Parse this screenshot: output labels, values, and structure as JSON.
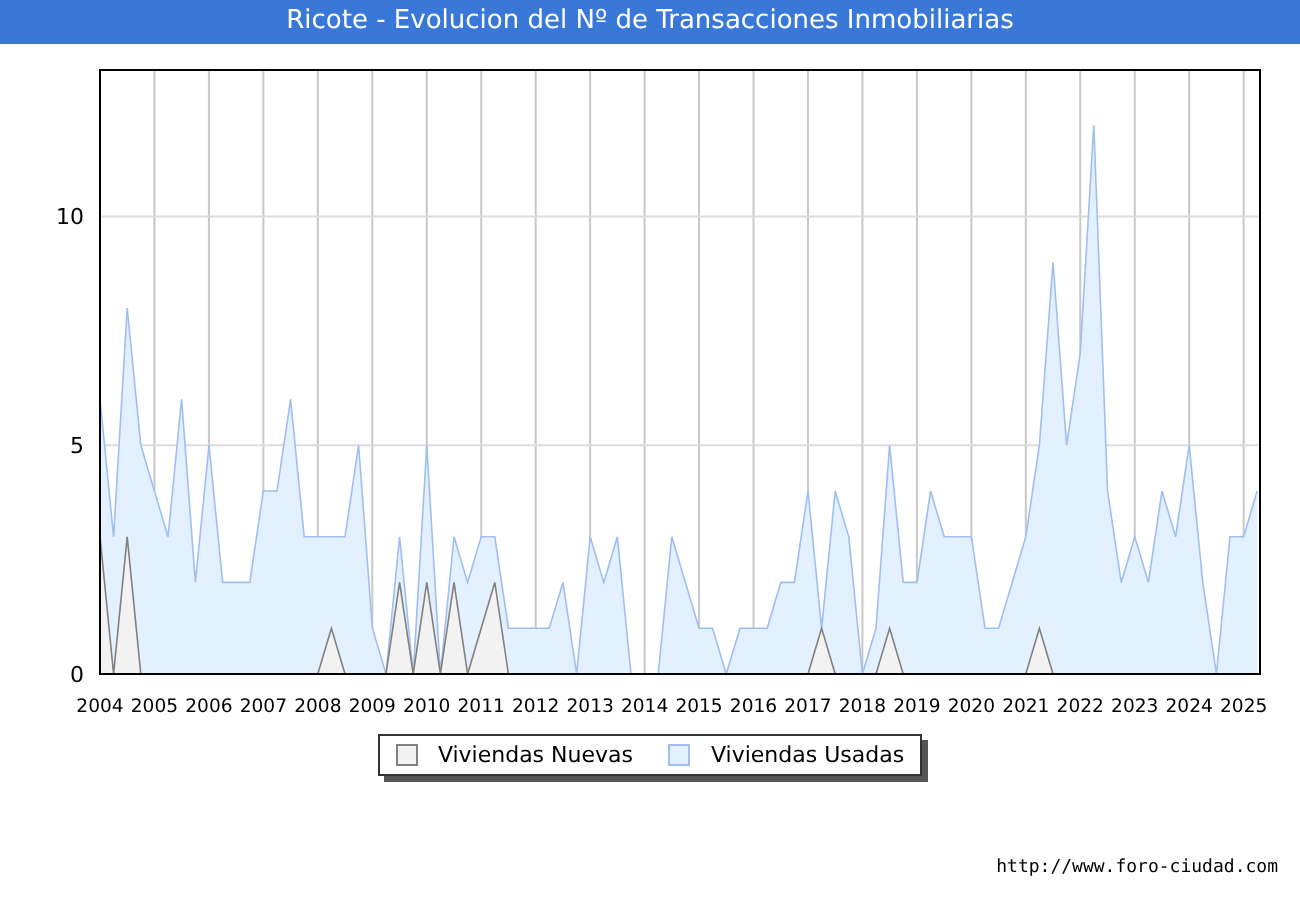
{
  "window": {
    "title": "Ricote - Evolucion del Nº de Transacciones Inmobiliarias"
  },
  "chart": {
    "chart_data": {
      "type": "area",
      "grid": true,
      "xlim": [
        2004,
        2025.3
      ],
      "ylim": [
        0,
        13.2
      ],
      "xticks": [
        2004,
        2005,
        2006,
        2007,
        2008,
        2009,
        2010,
        2011,
        2012,
        2013,
        2014,
        2015,
        2016,
        2017,
        2018,
        2019,
        2020,
        2021,
        2022,
        2023,
        2024,
        2025
      ],
      "yticks": [
        0,
        5,
        10
      ],
      "x": [
        2004,
        2004.25,
        2004.5,
        2004.75,
        2005,
        2005.25,
        2005.5,
        2005.75,
        2006,
        2006.25,
        2006.5,
        2006.75,
        2007,
        2007.25,
        2007.5,
        2007.75,
        2008,
        2008.25,
        2008.5,
        2008.75,
        2009,
        2009.25,
        2009.5,
        2009.75,
        2010,
        2010.25,
        2010.5,
        2010.75,
        2011,
        2011.25,
        2011.5,
        2011.75,
        2012,
        2012.25,
        2012.5,
        2012.75,
        2013,
        2013.25,
        2013.5,
        2013.75,
        2014,
        2014.25,
        2014.5,
        2014.75,
        2015,
        2015.25,
        2015.5,
        2015.75,
        2016,
        2016.25,
        2016.5,
        2016.75,
        2017,
        2017.25,
        2017.5,
        2017.75,
        2018,
        2018.25,
        2018.5,
        2018.75,
        2019,
        2019.25,
        2019.5,
        2019.75,
        2020,
        2020.25,
        2020.5,
        2020.75,
        2021,
        2021.25,
        2021.5,
        2021.75,
        2022,
        2022.25,
        2022.5,
        2022.75,
        2023,
        2023.25,
        2023.5,
        2023.75,
        2024,
        2024.25,
        2024.5,
        2024.75,
        2025,
        2025.25
      ],
      "series": [
        {
          "name": "Viviendas Nuevas",
          "color": "#808080",
          "values": [
            3,
            0,
            3,
            0,
            null,
            null,
            null,
            null,
            null,
            null,
            null,
            null,
            null,
            null,
            null,
            null,
            0,
            1,
            0,
            null,
            null,
            0,
            2,
            0,
            2,
            0,
            2,
            0,
            1,
            2,
            0,
            null,
            null,
            null,
            null,
            null,
            null,
            null,
            null,
            null,
            null,
            null,
            null,
            null,
            null,
            null,
            null,
            null,
            null,
            null,
            null,
            null,
            0,
            1,
            0,
            null,
            null,
            0,
            1,
            0,
            null,
            null,
            null,
            null,
            null,
            null,
            null,
            null,
            0,
            1,
            0,
            null,
            null,
            null,
            null,
            null,
            null,
            null,
            null,
            null,
            null,
            null,
            null,
            null,
            null,
            null
          ]
        },
        {
          "name": "Viviendas Usadas",
          "color": "#a0bff0",
          "values": [
            6,
            3,
            8,
            5,
            4,
            3,
            6,
            2,
            5,
            2,
            2,
            2,
            4,
            4,
            6,
            3,
            3,
            3,
            3,
            5,
            1,
            0,
            3,
            0,
            5,
            0,
            3,
            2,
            3,
            3,
            1,
            1,
            1,
            1,
            2,
            0,
            3,
            2,
            3,
            0,
            null,
            0,
            3,
            2,
            1,
            1,
            0,
            1,
            1,
            1,
            2,
            2,
            4,
            1,
            4,
            3,
            0,
            1,
            5,
            2,
            2,
            4,
            3,
            3,
            3,
            1,
            1,
            2,
            3,
            5,
            9,
            5,
            7,
            12,
            4,
            2,
            3,
            2,
            4,
            3,
            5,
            2,
            0,
            3,
            3,
            4
          ]
        }
      ]
    }
  },
  "footer": {
    "url": "http://www.foro-ciudad.com"
  }
}
